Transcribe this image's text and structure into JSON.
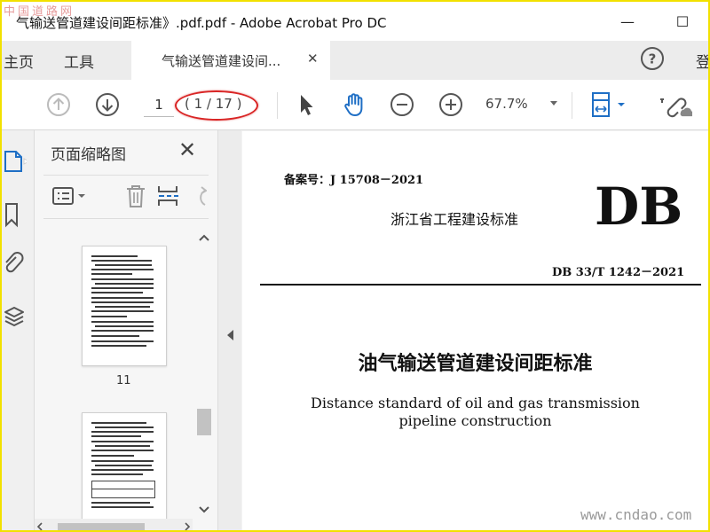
{
  "window": {
    "title": "气输送管道建设间距标准》.pdf.pdf - Adobe Acrobat Pro DC",
    "watermark_top": "中国道路网",
    "minimize_label": "—",
    "maximize_label": "☐"
  },
  "tabs": {
    "home": "主页",
    "tools": "工具",
    "document": "气输送管道建设间...",
    "close_label": "✕",
    "signin": "登"
  },
  "toolbar": {
    "page_number": "1",
    "page_total": "( 1 / 17 )",
    "zoom_value": "67.7%"
  },
  "thumb_panel": {
    "title": "页面缩略图",
    "close_label": "✕",
    "thumbnails": [
      {
        "label": "11"
      },
      {
        "label": ""
      }
    ]
  },
  "document": {
    "filing_number": "备案号：J 15708－2021",
    "standard_type": "浙江省工程建设标准",
    "logo": "DB",
    "standard_code": "DB 33/T 1242－2021",
    "title_cn": "油气输送管道建设间距标准",
    "title_en_line1": "Distance standard of oil and gas transmission",
    "title_en_line2": "pipeline construction"
  },
  "watermark": "www.cndao.com",
  "colors": {
    "accent_blue": "#1f6fc5",
    "annotation_red": "#d92525",
    "frame_yellow": "#f2e100"
  }
}
